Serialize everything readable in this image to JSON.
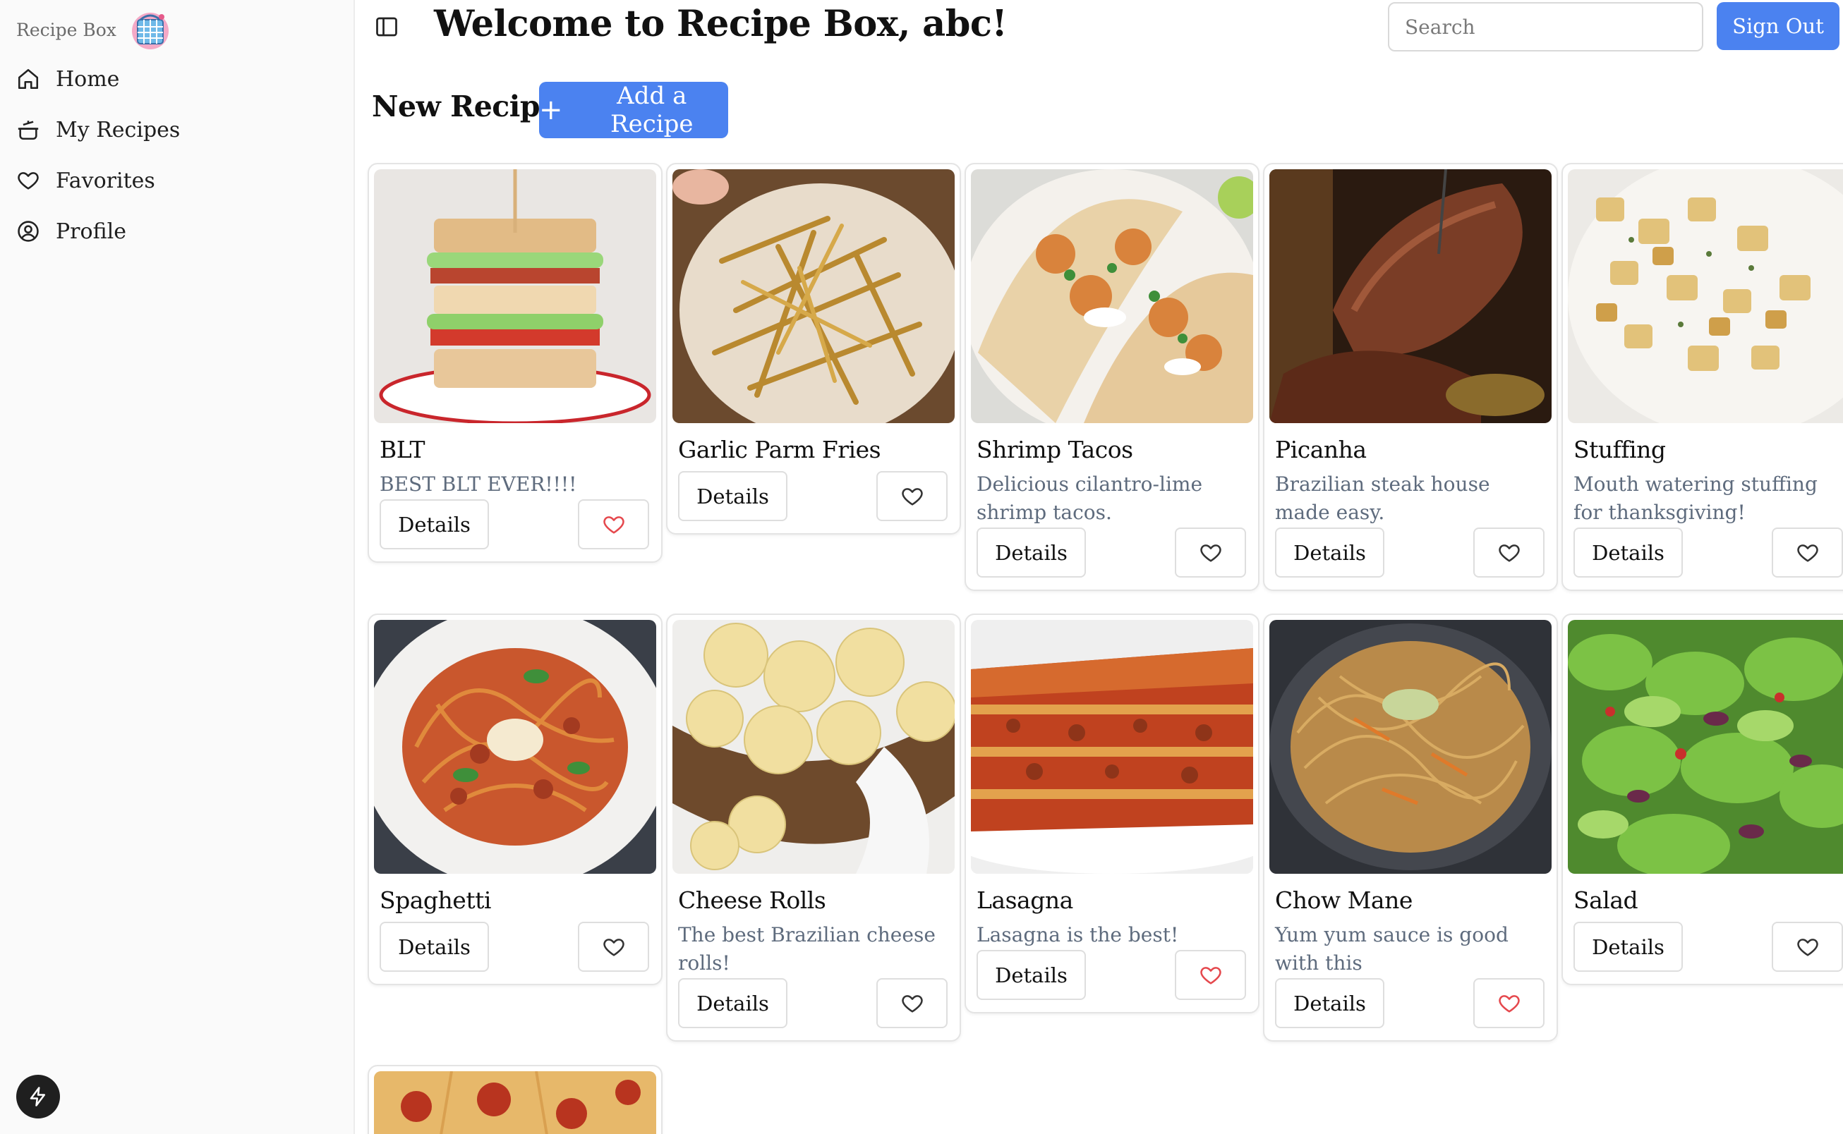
{
  "sidebar": {
    "brand": "Recipe Box",
    "items": [
      {
        "label": "Home"
      },
      {
        "label": "My Recipes"
      },
      {
        "label": "Favorites"
      },
      {
        "label": "Profile"
      }
    ]
  },
  "header": {
    "title": "Welcome to Recipe Box, abc!",
    "search_placeholder": "Search",
    "signout_label": "Sign Out"
  },
  "main": {
    "section_title": "New Recipes",
    "add_label": "Add a Recipe",
    "details_label": "Details",
    "recipes": [
      {
        "name": "BLT",
        "description": "BEST BLT EVER!!!!",
        "favorited": true,
        "icon": "blt-sandwich-icon"
      },
      {
        "name": "Garlic Parm Fries",
        "description": "",
        "favorited": false,
        "icon": "fries-icon"
      },
      {
        "name": "Shrimp Tacos",
        "description": "Delicious cilantro-lime shrimp tacos.",
        "favorited": false,
        "icon": "tacos-icon"
      },
      {
        "name": "Picanha",
        "description": "Brazilian steak house made easy.",
        "favorited": false,
        "icon": "steak-icon"
      },
      {
        "name": "Stuffing",
        "description": "Mouth watering stuffing for thanksgiving!",
        "favorited": false,
        "icon": "stuffing-icon"
      },
      {
        "name": "Spaghetti",
        "description": "",
        "favorited": false,
        "icon": "spaghetti-icon"
      },
      {
        "name": "Cheese Rolls",
        "description": "The best Brazilian cheese rolls!",
        "favorited": false,
        "icon": "cheese-rolls-icon"
      },
      {
        "name": "Lasagna",
        "description": "Lasagna is the best!",
        "favorited": true,
        "icon": "lasagna-icon"
      },
      {
        "name": "Chow Mane",
        "description": "Yum yum sauce is good with this",
        "favorited": true,
        "icon": "noodles-icon"
      },
      {
        "name": "Salad",
        "description": "",
        "favorited": false,
        "icon": "salad-icon"
      },
      {
        "name": "",
        "description": "",
        "favorited": false,
        "icon": "pizza-icon"
      }
    ]
  },
  "colors": {
    "accent": "#4b82f0",
    "favorite_heart": "#e5484d",
    "muted_text": "#5e6b7d"
  }
}
